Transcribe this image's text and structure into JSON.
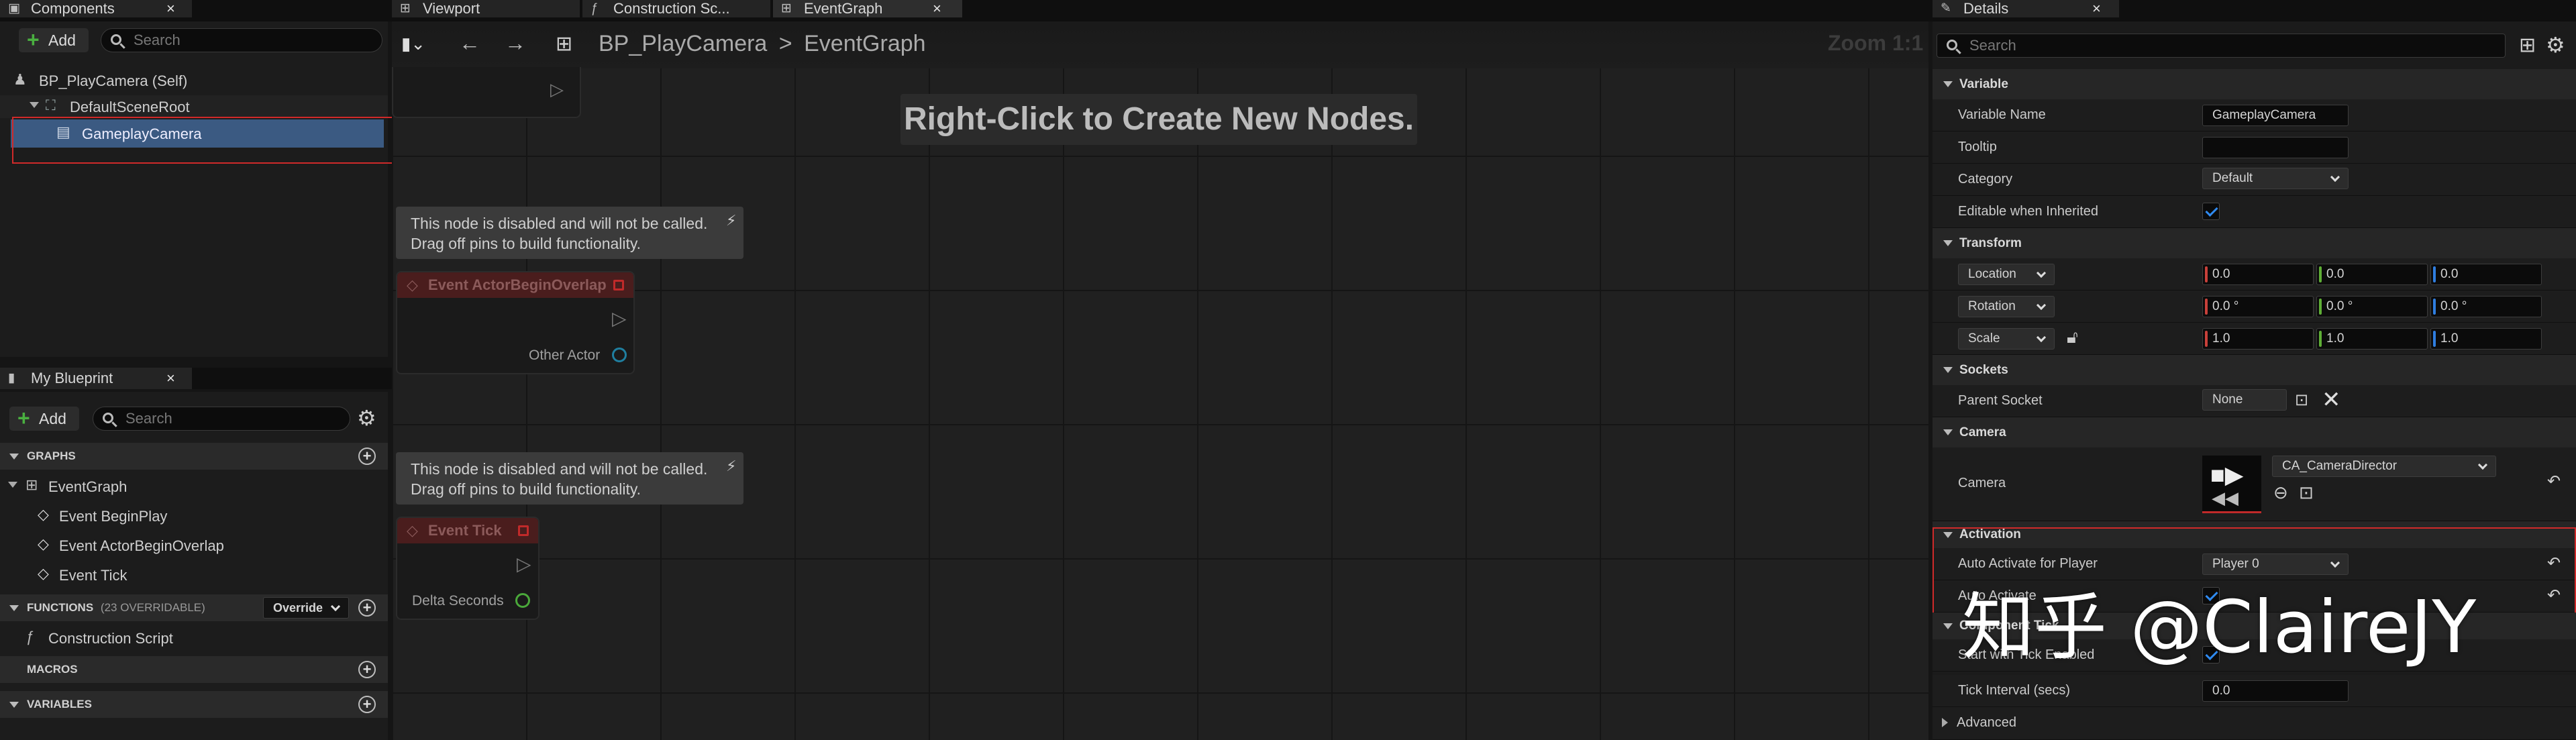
{
  "tabs": {
    "components": "Components",
    "viewport": "Viewport",
    "construction": "Construction Sc...",
    "eventgraph": "EventGraph",
    "details": "Details",
    "my_blueprint": "My Blueprint"
  },
  "components": {
    "add_label": "Add",
    "search_placeholder": "Search",
    "self_item": "BP_PlayCamera (Self)",
    "root_item": "DefaultSceneRoot",
    "camera_item": "GameplayCamera"
  },
  "my_blueprint": {
    "add_label": "Add",
    "search_placeholder": "Search",
    "graphs_header": "GRAPHS",
    "graph_items": [
      "EventGraph",
      "Event BeginPlay",
      "Event ActorBeginOverlap",
      "Event Tick"
    ],
    "functions_header": "FUNCTIONS",
    "functions_count": "(23 OVERRIDABLE)",
    "override_label": "Override",
    "function_items": [
      "Construction Script"
    ],
    "macros_header": "MACROS",
    "variables_header": "VARIABLES"
  },
  "graph": {
    "breadcrumb_root": "BP_PlayCamera",
    "breadcrumb_sep": ">",
    "breadcrumb_current": "EventGraph",
    "zoom": "Zoom 1:1",
    "hint": "Right-Click to Create New Nodes.",
    "disabled_comment_line1": "This node is disabled and will not be called.",
    "disabled_comment_line2": "Drag off pins to build functionality.",
    "node_overlap_title": "Event ActorBeginOverlap",
    "node_overlap_pin": "Other Actor",
    "node_tick_title": "Event Tick",
    "node_tick_pin": "Delta Seconds"
  },
  "details": {
    "search_placeholder": "Search",
    "variable_header": "Variable",
    "variable_name_label": "Variable Name",
    "variable_name_value": "GameplayCamera",
    "tooltip_label": "Tooltip",
    "tooltip_value": "",
    "category_label": "Category",
    "category_value": "Default",
    "editable_label": "Editable when Inherited",
    "transform_header": "Transform",
    "location_label": "Location",
    "rotation_label": "Rotation",
    "scale_label": "Scale",
    "location": [
      "0.0",
      "0.0",
      "0.0"
    ],
    "rotation": [
      "0.0 °",
      "0.0 °",
      "0.0 °"
    ],
    "scale": [
      "1.0",
      "1.0",
      "1.0"
    ],
    "sockets_header": "Sockets",
    "parent_socket_label": "Parent Socket",
    "parent_socket_value": "None",
    "camera_header": "Camera",
    "camera_label": "Camera",
    "camera_asset": "CA_CameraDirector",
    "activation_header": "Activation",
    "auto_activate_player_label": "Auto Activate for Player",
    "auto_activate_player_value": "Player 0",
    "auto_activate_label": "Auto Activate",
    "component_tick_header": "Component Tick",
    "start_with_tick_label": "Start with Tick Enabled",
    "tick_interval_label": "Tick Interval (secs)",
    "tick_interval_value": "0.0",
    "advanced_label": "Advanced"
  },
  "watermark": "知乎 @ClaireJY",
  "colors": {
    "selection": "#3b5a82",
    "highlight_box": "#d02a2a",
    "checkbox_tick": "#2f8af0",
    "event_node_header": "#4a1d1d"
  }
}
